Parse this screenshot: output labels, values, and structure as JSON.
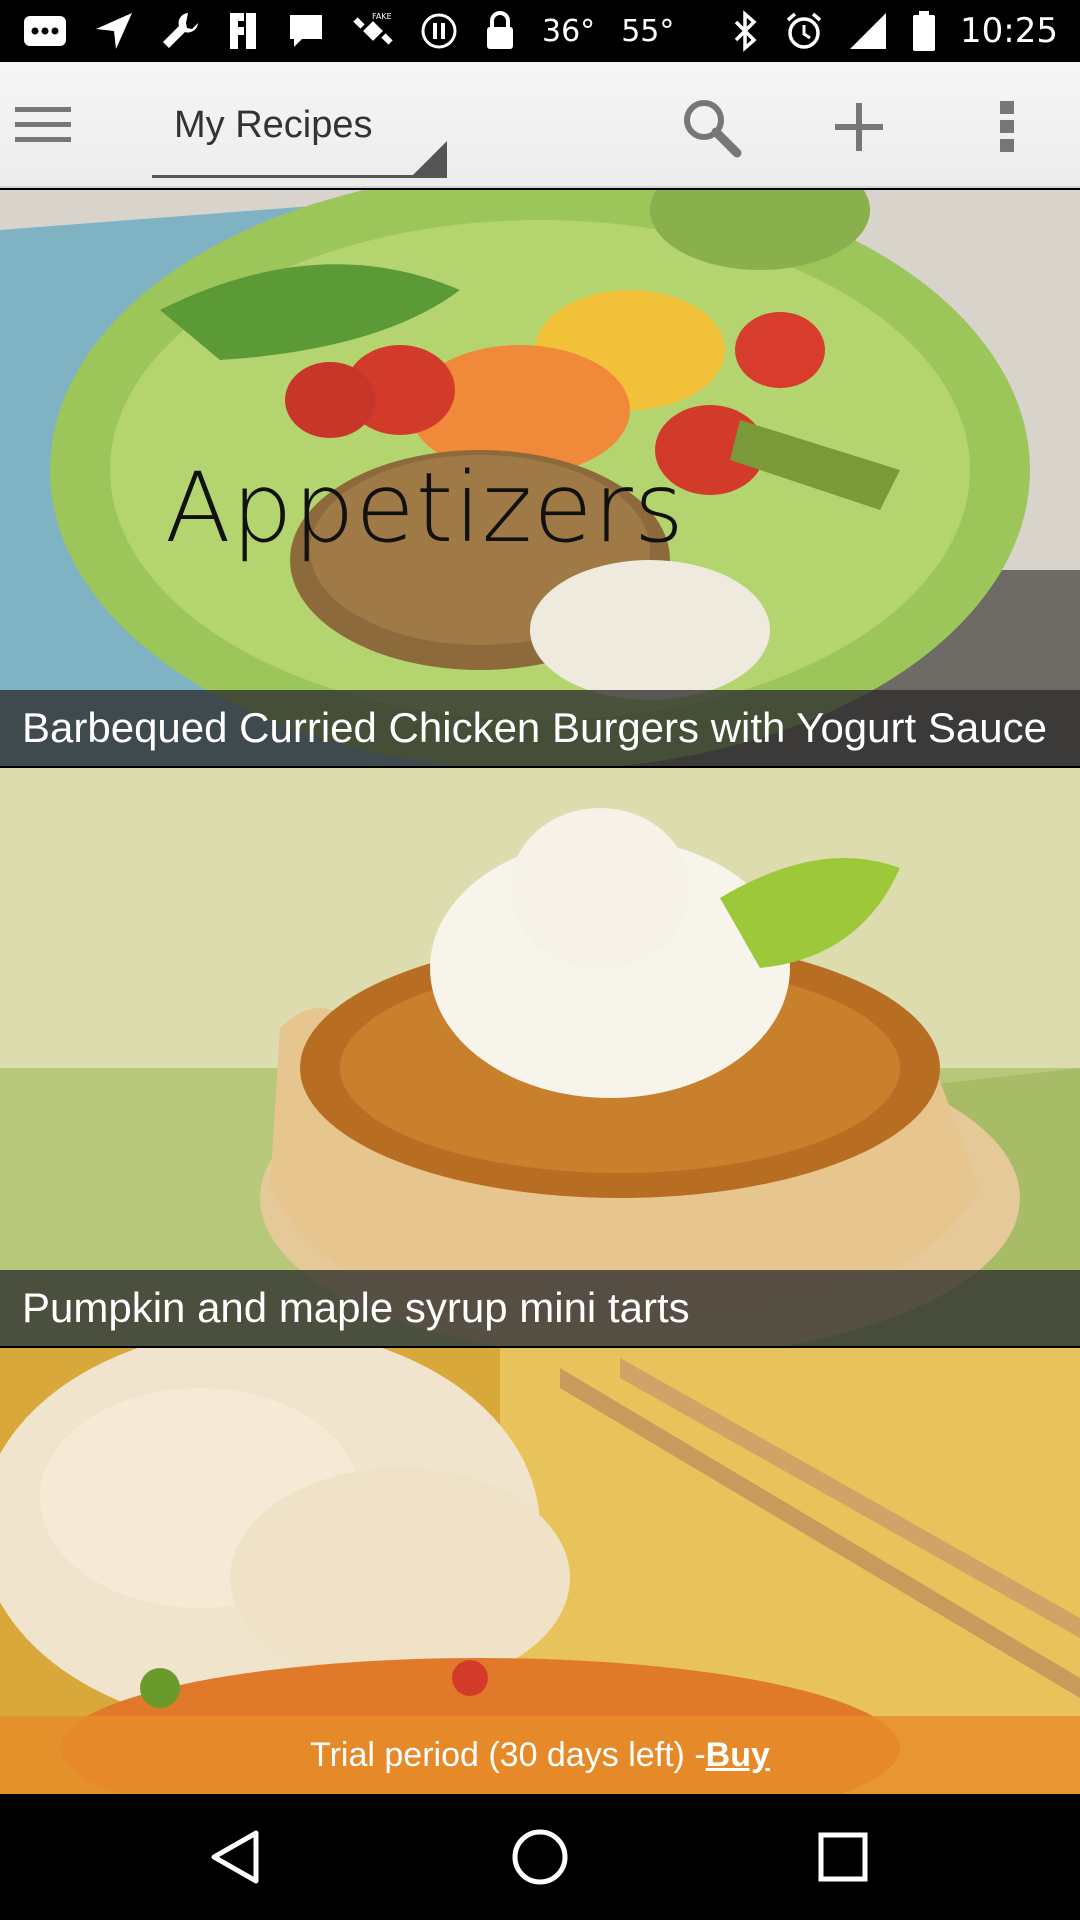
{
  "status_bar": {
    "temp1": "36°",
    "temp2": "55°",
    "time": "10:25"
  },
  "action_bar": {
    "title": "My Recipes"
  },
  "recipes": [
    {
      "section": "Appetizers",
      "title": "Barbequed Curried Chicken Burgers with Yogurt Sauce"
    },
    {
      "title": "Pumpkin and maple syrup mini tarts"
    },
    {
      "title": ""
    }
  ],
  "trial": {
    "text": "Trial period (30 days left) - ",
    "buy_label": "Buy"
  },
  "colors": {
    "accent": "#e68c28",
    "caption_bg": "#2d2d2d",
    "action_bar_bg": "#f2f2f2"
  }
}
